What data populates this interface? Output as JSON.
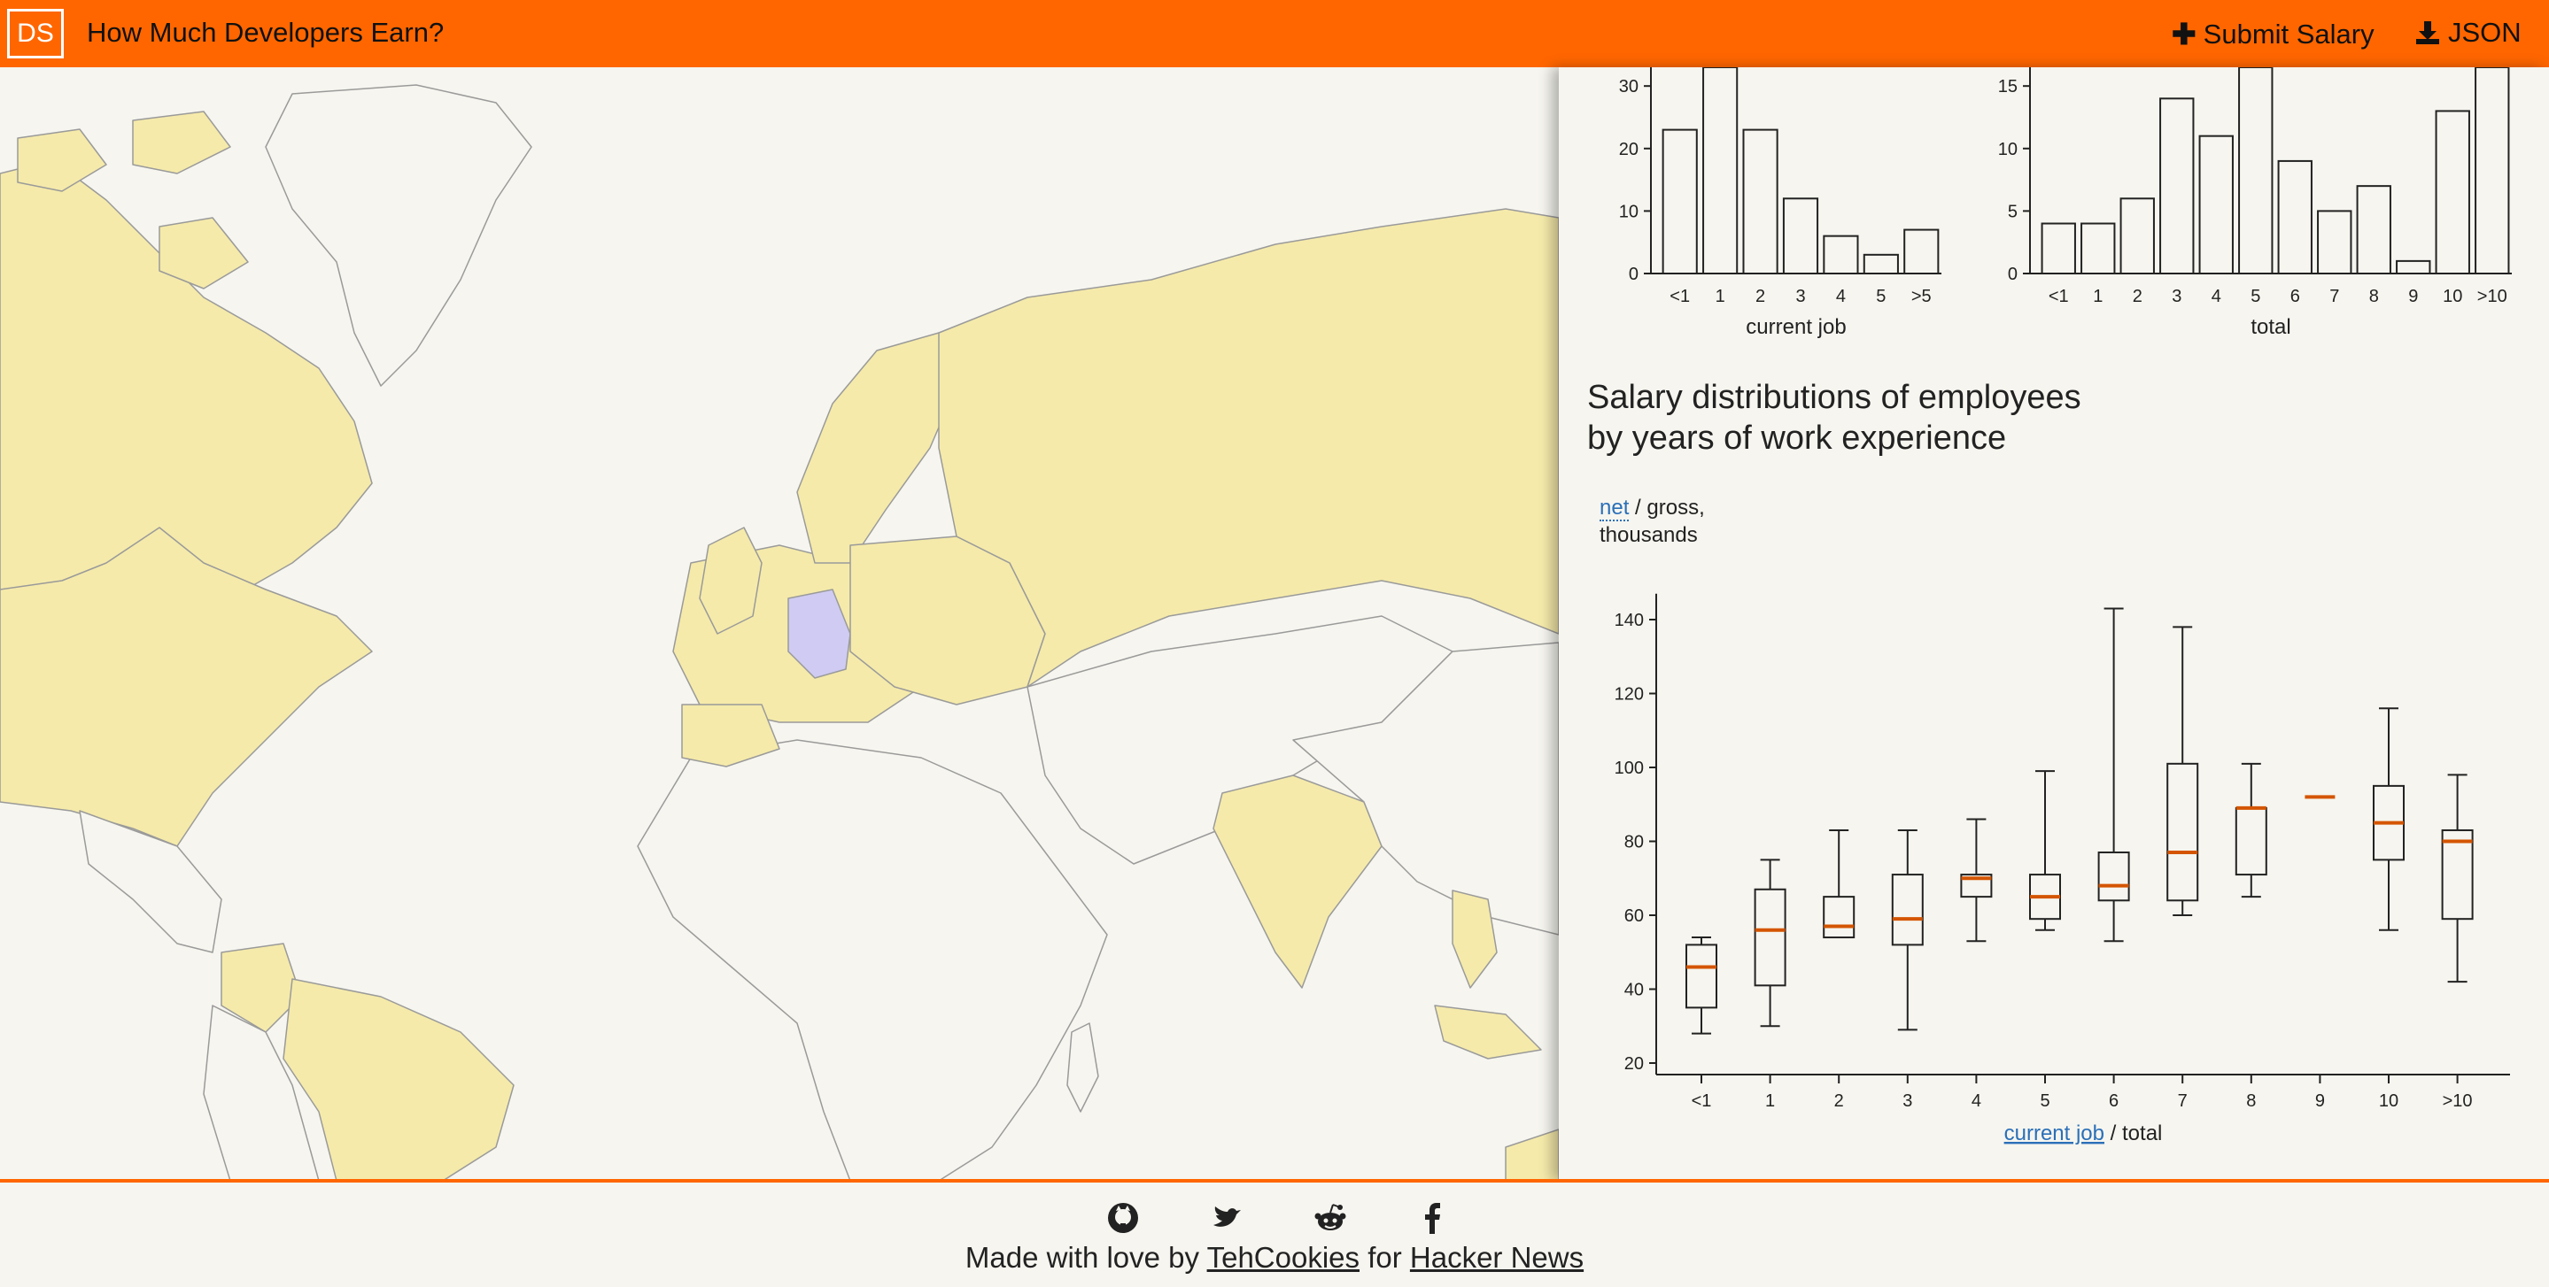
{
  "header": {
    "logo": "DS",
    "title": "How Much Developers Earn?",
    "submit_label": "Submit Salary",
    "json_label": "JSON"
  },
  "map": {
    "highlight_country": "Germany",
    "colors": {
      "ocean": "#f6f5ef",
      "land": "#f6f5ef",
      "with_data": "#f5eaaa",
      "selected": "#cfcbf2",
      "border": "#9a9a9a"
    }
  },
  "right_panel": {
    "histogram_current_label": "current job",
    "histogram_total_label": "total",
    "title_line1": "Salary distributions of employees",
    "title_line2": "by years of work experience",
    "unit_net": "net",
    "unit_rest": " / gross,",
    "unit_thousands": "thousands",
    "x_link": "current job",
    "x_rest": " / total"
  },
  "footer": {
    "icons": [
      "github-icon",
      "twitter-icon",
      "reddit-icon",
      "facebook-icon"
    ],
    "made_with": "Made with love by ",
    "author": "TehCookies",
    "for_text": " for ",
    "community": "Hacker News"
  },
  "chart_data": [
    {
      "type": "bar",
      "title": "",
      "xlabel": "current job",
      "ylabel": "",
      "categories": [
        "<1",
        "1",
        "2",
        "3",
        "4",
        "5",
        ">5"
      ],
      "values": [
        23,
        35,
        23,
        12,
        6,
        3,
        7
      ],
      "yticks": [
        0,
        10,
        20,
        30
      ],
      "ylim": [
        0,
        33
      ],
      "grid": false
    },
    {
      "type": "bar",
      "title": "",
      "xlabel": "total",
      "ylabel": "",
      "categories": [
        "<1",
        "1",
        "2",
        "3",
        "4",
        "5",
        "6",
        "7",
        "8",
        "9",
        "10",
        ">10"
      ],
      "values": [
        4,
        4,
        6,
        14,
        11,
        18,
        9,
        5,
        7,
        1,
        13,
        18
      ],
      "yticks": [
        0,
        5,
        10,
        15
      ],
      "ylim": [
        0,
        16.5
      ],
      "grid": false
    },
    {
      "type": "box",
      "title": "Salary distributions of employees by years of work experience",
      "xlabel": "current job / total",
      "ylabel": "net / gross, thousands",
      "categories": [
        "<1",
        "1",
        "2",
        "3",
        "4",
        "5",
        "6",
        "7",
        "8",
        "9",
        "10",
        ">10"
      ],
      "boxes": [
        {
          "min": 28,
          "q1": 35,
          "median": 46,
          "q3": 52,
          "max": 54
        },
        {
          "min": 30,
          "q1": 41,
          "median": 56,
          "q3": 67,
          "max": 75
        },
        {
          "min": 54,
          "q1": 54,
          "median": 57,
          "q3": 65,
          "max": 83
        },
        {
          "min": 29,
          "q1": 52,
          "median": 59,
          "q3": 71,
          "max": 83
        },
        {
          "min": 53,
          "q1": 65,
          "median": 70,
          "q3": 71,
          "max": 86
        },
        {
          "min": 56,
          "q1": 59,
          "median": 65,
          "q3": 71,
          "max": 99
        },
        {
          "min": 53,
          "q1": 64,
          "median": 68,
          "q3": 77,
          "max": 143
        },
        {
          "min": 60,
          "q1": 64,
          "median": 77,
          "q3": 101,
          "max": 138
        },
        {
          "min": 65,
          "q1": 71,
          "median": 89,
          "q3": 89,
          "max": 101
        },
        {
          "min": 92,
          "q1": 92,
          "median": 92,
          "q3": 92,
          "max": 92
        },
        {
          "min": 56,
          "q1": 75,
          "median": 85,
          "q3": 95,
          "max": 116
        },
        {
          "min": 42,
          "q1": 59,
          "median": 80,
          "q3": 83,
          "max": 98
        }
      ],
      "yticks": [
        20,
        40,
        60,
        80,
        100,
        120,
        140
      ],
      "ylim": [
        17,
        147
      ],
      "colors": {
        "median": "#d45500",
        "box": "#222222"
      },
      "grid": false
    }
  ]
}
